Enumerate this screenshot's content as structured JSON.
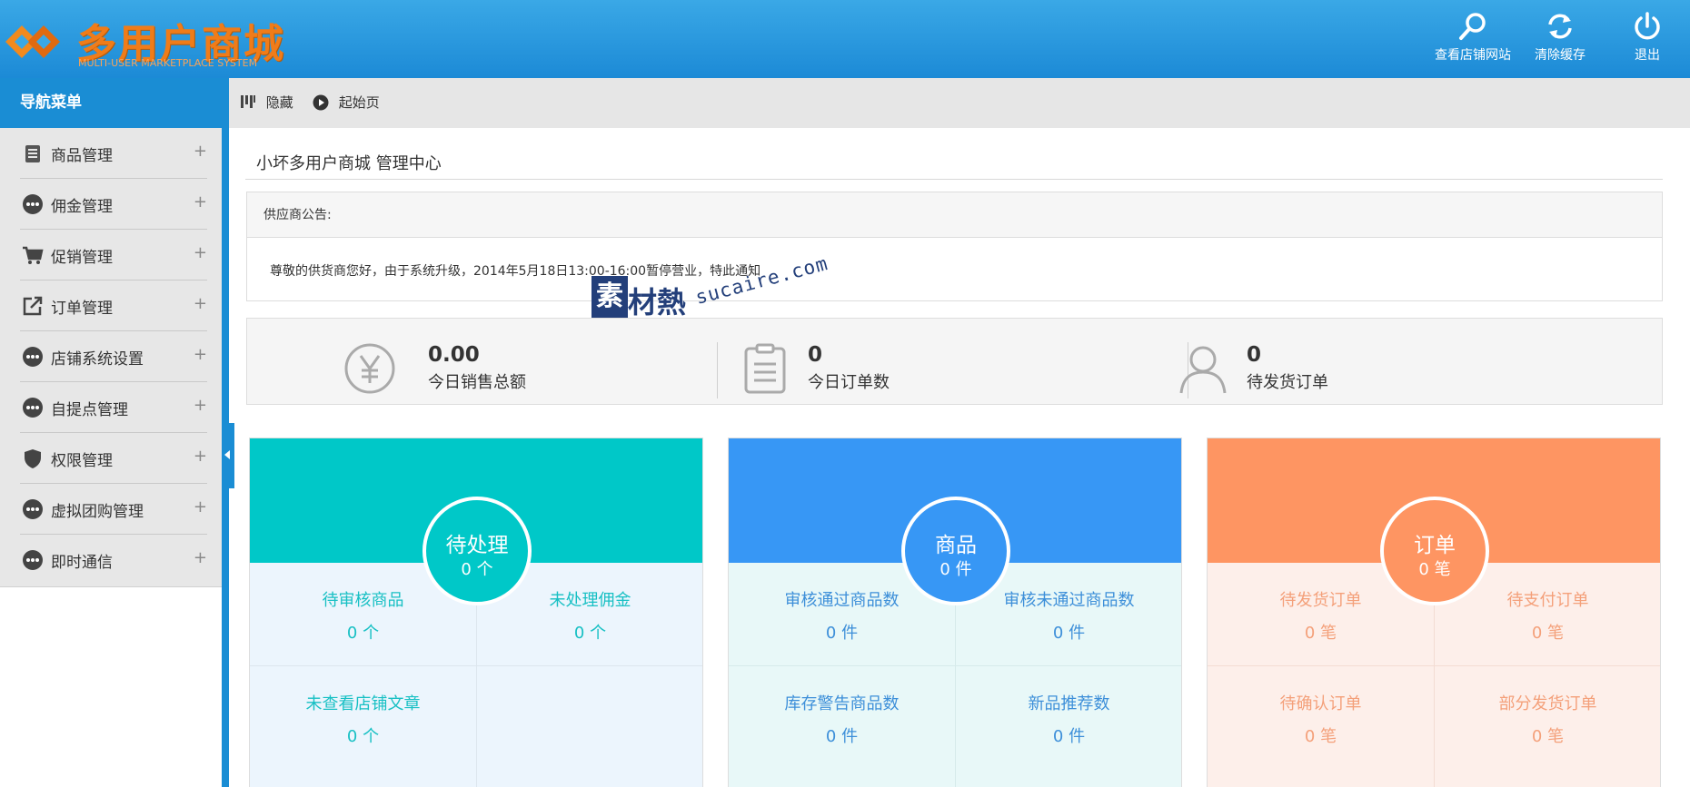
{
  "colors": {
    "primary": "#1a8dd4",
    "teal": "#00c8c8",
    "blue": "#3797f5",
    "orange": "#fe9562"
  },
  "header": {
    "logo_title": "多用户商城",
    "logo_subtitle": "MULTI-USER MARKETPLACE SYSTEM",
    "buttons": [
      {
        "label": "查看店铺网站",
        "icon": "search-icon"
      },
      {
        "label": "清除缓存",
        "icon": "refresh-icon"
      },
      {
        "label": "退出",
        "icon": "power-icon"
      }
    ]
  },
  "sidebar": {
    "title": "导航菜单",
    "items": [
      {
        "label": "商品管理",
        "icon": "clipboard-icon"
      },
      {
        "label": "佣金管理",
        "icon": "dots-icon"
      },
      {
        "label": "促销管理",
        "icon": "cart-icon"
      },
      {
        "label": "订单管理",
        "icon": "export-icon"
      },
      {
        "label": "店铺系统设置",
        "icon": "dots-icon"
      },
      {
        "label": "自提点管理",
        "icon": "dots-icon"
      },
      {
        "label": "权限管理",
        "icon": "shield-icon"
      },
      {
        "label": "虚拟团购管理",
        "icon": "dots-icon"
      },
      {
        "label": "即时通信",
        "icon": "dots-icon"
      }
    ],
    "expand_symbol": "+"
  },
  "toolbar": {
    "hide_label": "隐藏",
    "home_label": "起始页"
  },
  "main": {
    "title": "小坏多用户商城 管理中心",
    "notice": {
      "heading": "供应商公告:",
      "body": "尊敬的供货商您好，由于系统升级，2014年5月18日13:00-16:00暂停营业，特此通知"
    },
    "stats": [
      {
        "value": "0.00",
        "label": "今日销售总额",
        "icon": "yen-icon"
      },
      {
        "value": "0",
        "label": "今日订单数",
        "icon": "clipboard-icon"
      },
      {
        "value": "0",
        "label": "待发货订单",
        "icon": "user-icon"
      }
    ],
    "cards": [
      {
        "title": "待处理",
        "count": "0 个",
        "cells": [
          {
            "label": "待审核商品",
            "value": "0 个"
          },
          {
            "label": "未处理佣金",
            "value": "0 个"
          },
          {
            "label": "未查看店铺文章",
            "value": "0 个"
          },
          {
            "label": "",
            "value": ""
          }
        ]
      },
      {
        "title": "商品",
        "count": "0 件",
        "cells": [
          {
            "label": "审核通过商品数",
            "value": "0 件"
          },
          {
            "label": "审核未通过商品数",
            "value": "0 件"
          },
          {
            "label": "库存警告商品数",
            "value": "0 件"
          },
          {
            "label": "新品推荐数",
            "value": "0 件"
          }
        ]
      },
      {
        "title": "订单",
        "count": "0 笔",
        "cells": [
          {
            "label": "待发货订单",
            "value": "0 笔"
          },
          {
            "label": "待支付订单",
            "value": "0 笔"
          },
          {
            "label": "待确认订单",
            "value": "0 笔"
          },
          {
            "label": "部分发货订单",
            "value": "0 笔"
          }
        ]
      }
    ]
  },
  "watermark": {
    "box": "素",
    "cn": "材熱",
    "en": "sucaire.com"
  }
}
